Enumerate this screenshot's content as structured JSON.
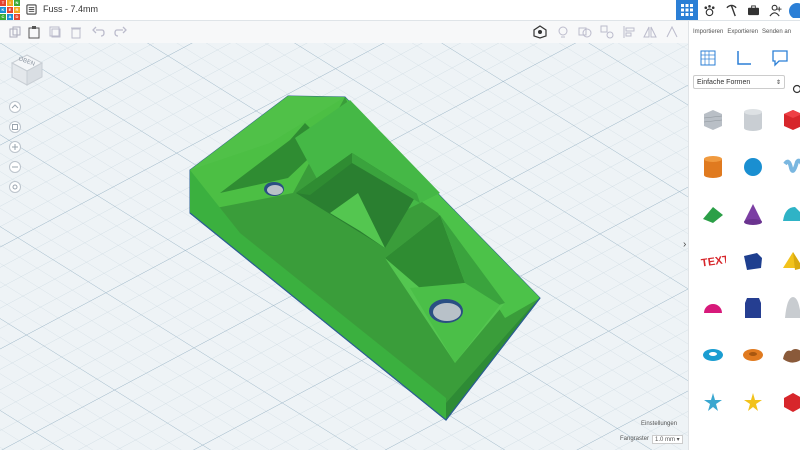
{
  "app": {
    "title": "Fuss - 7.4mm",
    "logo_letters": [
      "T",
      "I",
      "N",
      "K",
      "E",
      "R",
      "C",
      "A",
      "D"
    ]
  },
  "toolbar_right": {
    "import_label": "Importieren",
    "export_label": "Exportieren",
    "send_label": "Senden an"
  },
  "shapes_panel": {
    "category_selected": "Einfache Formen"
  },
  "viewcube": {
    "label": "OBEN"
  },
  "bottom": {
    "settings_label": "Einstellungen",
    "snap_label": "Fangraster",
    "snap_value": "1.0 mm"
  },
  "colors": {
    "accent": "#2b7fd6",
    "model_green": "#3cb043",
    "model_dark": "#2b8a31"
  },
  "shapes": [
    {
      "name": "box-hole-shape",
      "color": "#b9bfc6"
    },
    {
      "name": "cylinder-hole-shape",
      "color": "#c9ced3"
    },
    {
      "name": "box-shape",
      "color": "#d7262b"
    },
    {
      "name": "cylinder-shape",
      "color": "#e07a1f"
    },
    {
      "name": "sphere-shape",
      "color": "#1a8fd1"
    },
    {
      "name": "scribble-shape",
      "color": "#7ab7e0"
    },
    {
      "name": "roof-shape",
      "color": "#2b9f47"
    },
    {
      "name": "cone-shape",
      "color": "#7b3fa3"
    },
    {
      "name": "round-roof-shape",
      "color": "#2fb3c6"
    },
    {
      "name": "text-shape",
      "color": "#d7262b"
    },
    {
      "name": "torus-shape",
      "color": "#1e3f8f"
    },
    {
      "name": "pyramid-shape",
      "color": "#f2c21b"
    },
    {
      "name": "half-sphere-shape",
      "color": "#d7197a"
    },
    {
      "name": "polygon-shape",
      "color": "#253e91"
    },
    {
      "name": "paraboloid-shape",
      "color": "#c8ccd0"
    },
    {
      "name": "ring-shape",
      "color": "#1a9dd1"
    },
    {
      "name": "tube-shape",
      "color": "#e07a1f"
    },
    {
      "name": "rock-shape",
      "color": "#8a5a3a"
    },
    {
      "name": "star-shape",
      "color": "#3aa7d0"
    },
    {
      "name": "star-yellow-shape",
      "color": "#f2c21b"
    },
    {
      "name": "icosahedron-shape",
      "color": "#d7262b"
    }
  ]
}
